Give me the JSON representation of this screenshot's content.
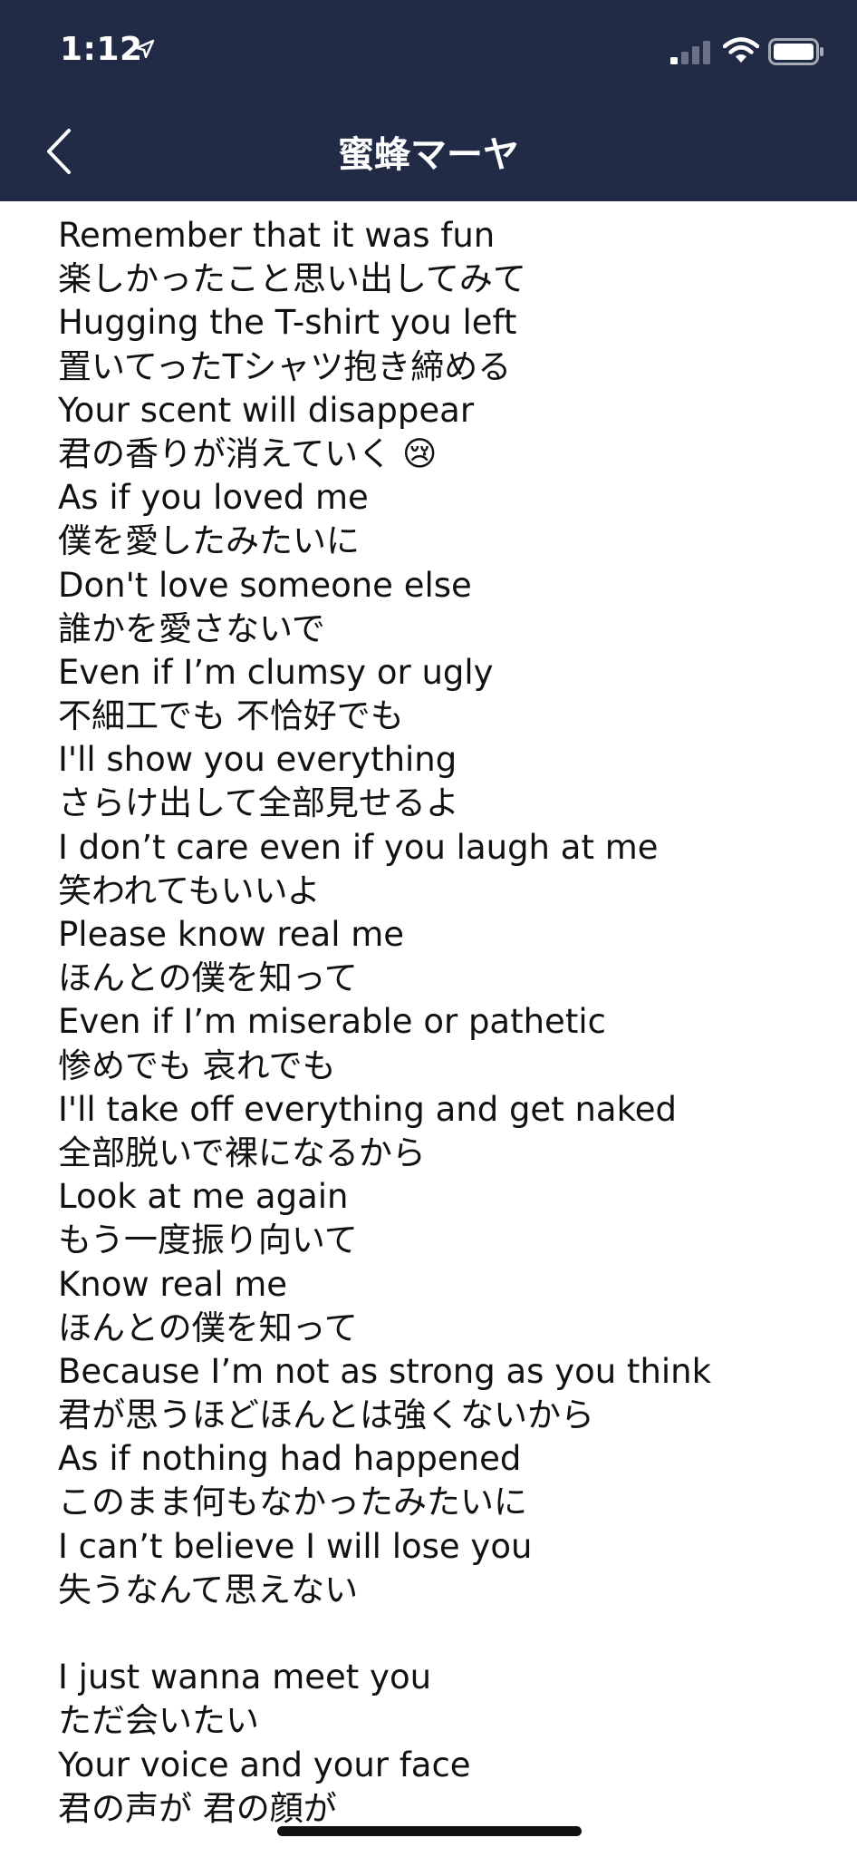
{
  "status_bar": {
    "time": "1:12"
  },
  "nav": {
    "title": "蜜蜂マーヤ"
  },
  "icons": {
    "back": "chevron-left-icon",
    "location": "location-arrow-icon",
    "signal": "cellular-signal-icon",
    "wifi": "wifi-icon",
    "battery": "battery-icon"
  },
  "colors": {
    "header_bg": "#222b45",
    "text": "#111111"
  },
  "lyrics": [
    "Remember that it was fun",
    "楽しかったこと思い出してみて",
    "Hugging the T-shirt you left",
    "置いてったTシャツ抱き締める",
    "Your scent will disappear",
    "君の香りが消えていく 😢",
    "As if you loved me",
    "僕を愛したみたいに",
    "Don't love someone else",
    "誰かを愛さないで",
    "Even if I’m clumsy or ugly",
    "不細工でも 不恰好でも",
    "I'll show you everything",
    "さらけ出して全部見せるよ",
    "I don’t care even if you laugh at me",
    "笑われてもいいよ",
    "Please know real me",
    "ほんとの僕を知って",
    "Even if I’m miserable or pathetic",
    "惨めでも 哀れでも",
    "I'll take off everything and get naked",
    "全部脱いで裸になるから",
    "Look at me again",
    "もう一度振り向いて",
    "Know real me",
    "ほんとの僕を知って",
    "Because I’m not as strong as you think",
    "君が思うほどほんとは強くないから",
    "As if nothing had happened",
    "このまま何もなかったみたいに",
    "I can’t believe I will lose you",
    "失うなんて思えない",
    "",
    "I just wanna meet you",
    "ただ会いたい",
    "Your voice and your face",
    "君の声が 君の顔が"
  ]
}
